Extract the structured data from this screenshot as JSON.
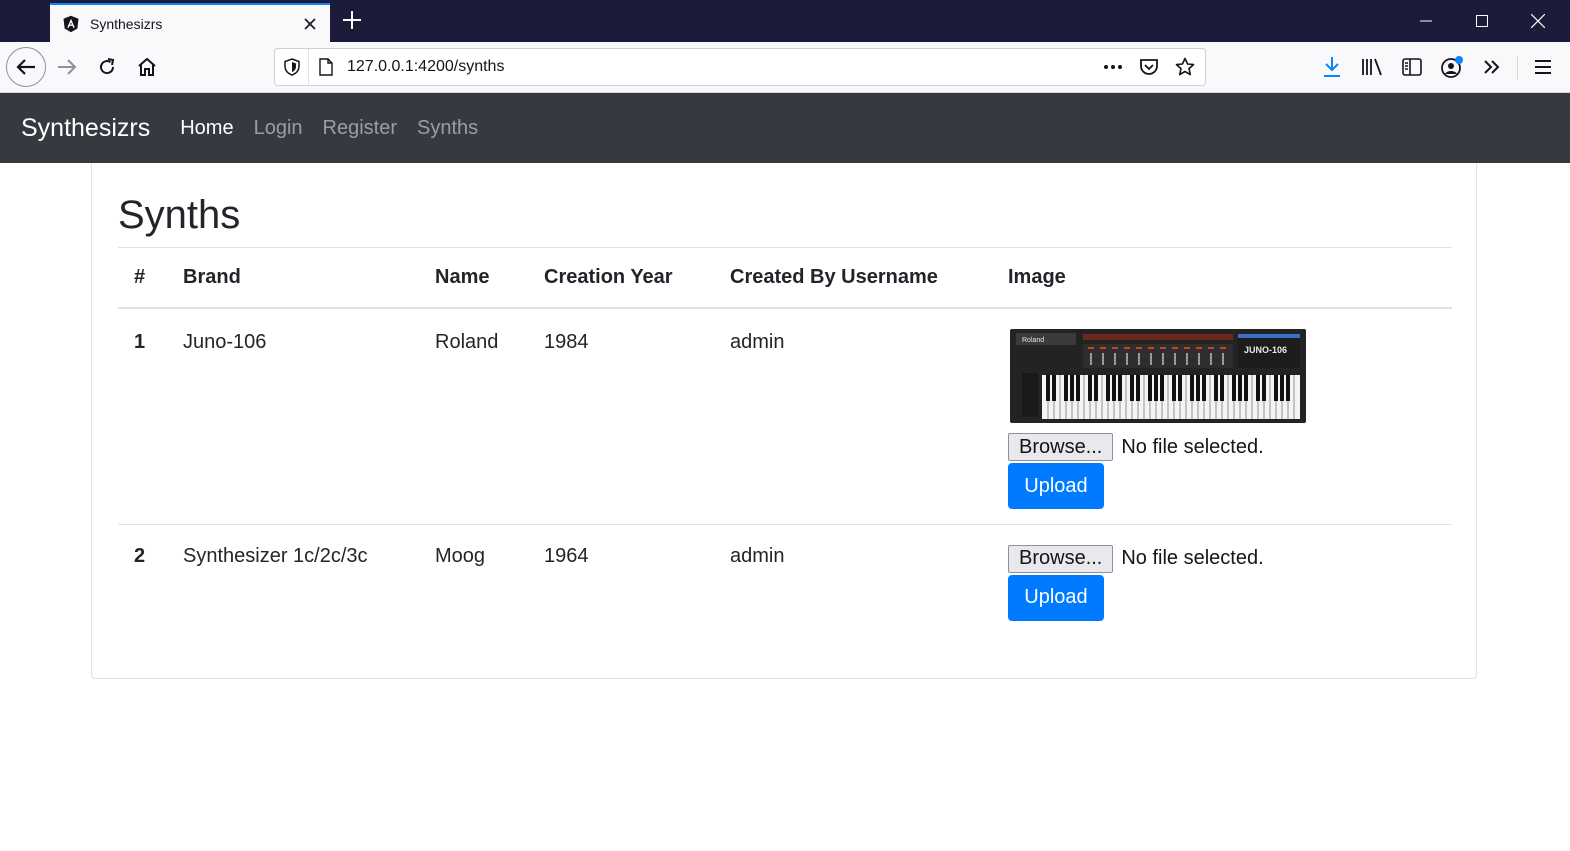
{
  "browser": {
    "tab_title": "Synthesizrs",
    "url": "127.0.0.1:4200/synths"
  },
  "app": {
    "brand": "Synthesizrs",
    "nav": [
      {
        "label": "Home",
        "active": true
      },
      {
        "label": "Login",
        "active": false
      },
      {
        "label": "Register",
        "active": false
      },
      {
        "label": "Synths",
        "active": false
      }
    ]
  },
  "page": {
    "title": "Synths",
    "table": {
      "headers": [
        "#",
        "Brand",
        "Name",
        "Creation Year",
        "Created By Username",
        "Image"
      ],
      "rows": [
        {
          "num": "1",
          "brand": "Juno-106",
          "name": "Roland",
          "year": "1984",
          "user": "admin",
          "has_image": true,
          "image_label": "Roland",
          "image_model": "JUNO-106",
          "browse_label": "Browse...",
          "file_status": "No file selected.",
          "upload_label": "Upload"
        },
        {
          "num": "2",
          "brand": "Synthesizer 1c/2c/3c",
          "name": "Moog",
          "year": "1964",
          "user": "admin",
          "has_image": false,
          "browse_label": "Browse...",
          "file_status": "No file selected.",
          "upload_label": "Upload"
        }
      ]
    }
  },
  "colors": {
    "navbar_bg": "#343a40",
    "primary": "#007bff",
    "browser_tabbar": "#1c1b3a"
  }
}
